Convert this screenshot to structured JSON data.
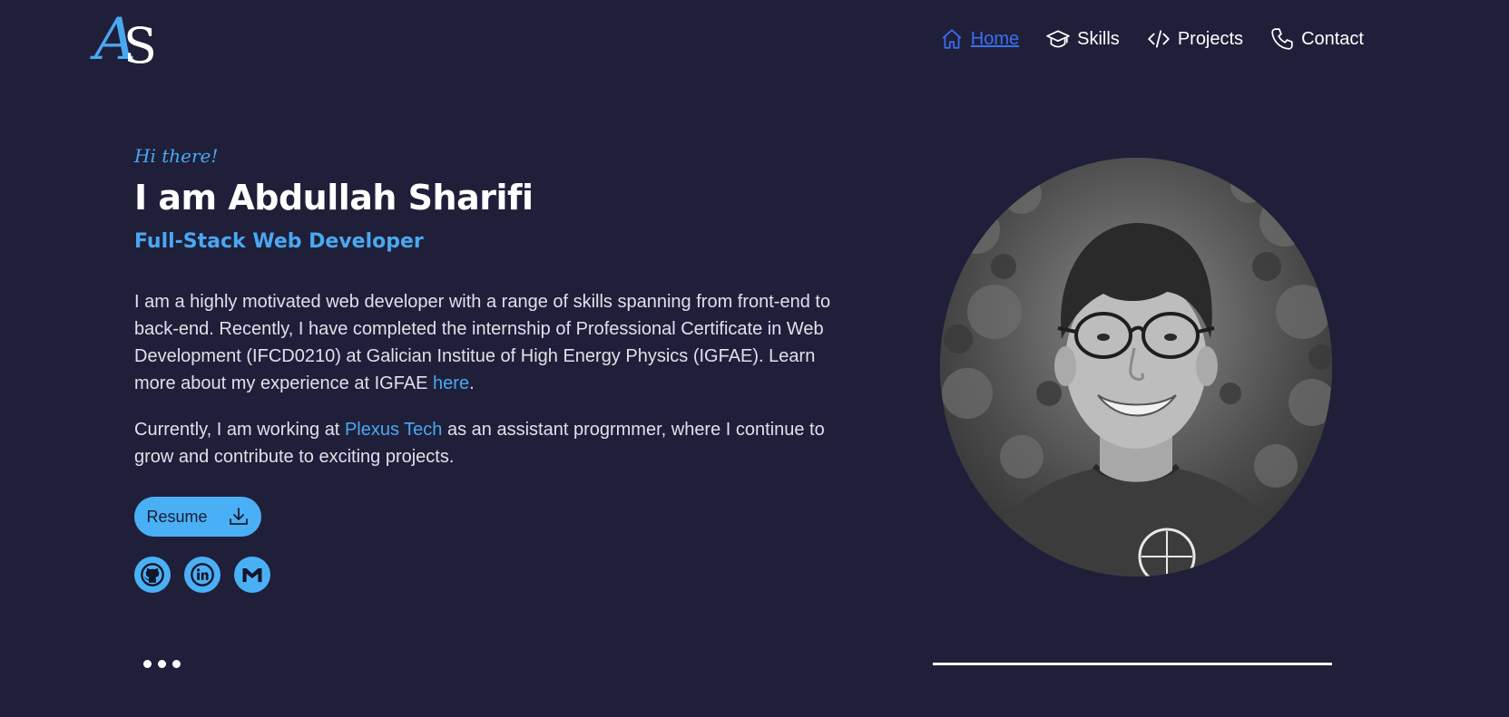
{
  "header": {
    "logo_text_a": "A",
    "logo_text_s": "S",
    "nav": [
      {
        "label": "Home",
        "icon": "home-icon",
        "active": true
      },
      {
        "label": "Skills",
        "icon": "graduation-cap-icon",
        "active": false
      },
      {
        "label": "Projects",
        "icon": "code-icon",
        "active": false
      },
      {
        "label": "Contact",
        "icon": "phone-icon",
        "active": false
      }
    ]
  },
  "hero": {
    "greeting": "Hi there!",
    "name": "I am Abdullah Sharifi",
    "role": "Full-Stack Web Developer",
    "para1_text": "I am a highly motivated web developer with a range of skills spanning from front-end to back-end. Recently, I have completed the internship of Professional Certificate in Web Development (IFCD0210) at Galician Institue of High Energy Physics (IGFAE). Learn more about my experience at IGFAE ",
    "para1_link": "here",
    "para1_end": ".",
    "para2_start": "Currently, I am working at ",
    "para2_link": "Plexus Tech",
    "para2_end": " as an assistant progrmmer, where I continue to grow and contribute to exciting projects.",
    "resume_label": "Resume",
    "socials": [
      "github-icon",
      "linkedin-icon",
      "gmail-icon"
    ]
  },
  "colors": {
    "background": "#1f1f3a",
    "accent": "#4aa8f0",
    "active_nav": "#3b6ff0",
    "text": "#e0e0ea"
  }
}
